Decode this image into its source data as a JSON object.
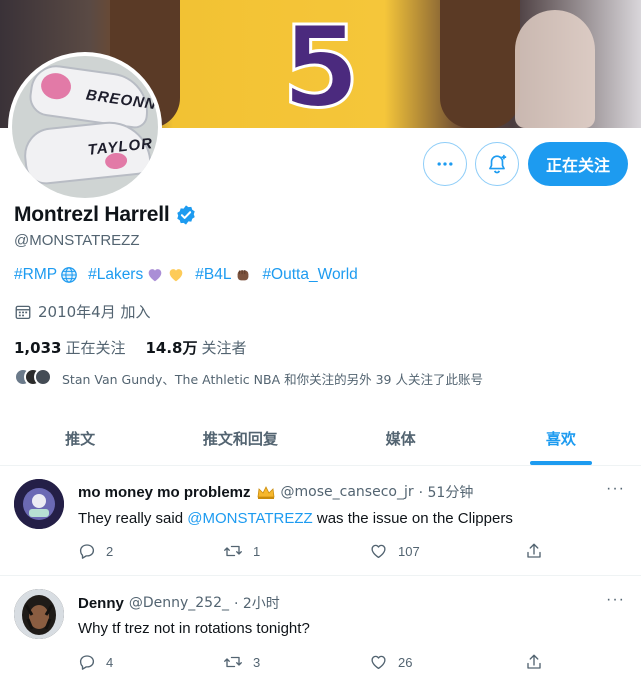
{
  "banner": {
    "jersey_number": "5"
  },
  "avatar": {
    "shoe_top_label": "BREONNA",
    "shoe_bottom_label": "TAYLOR"
  },
  "actions": {
    "follow_label": "正在关注"
  },
  "profile": {
    "display_name": "Montrezl Harrell",
    "handle": "@MONSTATREZZ",
    "bio": {
      "tag1": "#RMP",
      "tag2": "#Lakers",
      "tag3": "#B4L",
      "tag4": "#Outta_World"
    },
    "joined": "2010年4月 加入",
    "following_count": "1,033",
    "following_label": "正在关注",
    "followers_count": "14.8万",
    "followers_label": "关注者",
    "followed_by": "Stan Van Gundy、The Athletic NBA 和你关注的另外 39 人关注了此账号"
  },
  "tabs": [
    {
      "label": "推文"
    },
    {
      "label": "推文和回复"
    },
    {
      "label": "媒体"
    },
    {
      "label": "喜欢"
    }
  ],
  "tweets": [
    {
      "name": "mo money mo problemz",
      "handle": "@mose_canseco_jr",
      "time": "· 51分钟",
      "text_before": "They really said ",
      "mention": "@MONSTATREZZ",
      "text_after": " was the issue on the Clippers",
      "replies": "2",
      "retweets": "1",
      "likes": "107"
    },
    {
      "name": "Denny",
      "handle": "@Denny_252_",
      "time": "· 2小时",
      "text_before": "Why tf trez not in rotations tonight?",
      "mention": "",
      "text_after": "",
      "replies": "4",
      "retweets": "3",
      "likes": "26"
    }
  ],
  "colors": {
    "accent": "#1d9bf0",
    "text": "#0f1419",
    "muted": "#536471",
    "border": "#eff3f4"
  },
  "icons": [
    "more-icon",
    "bell-plus-icon",
    "verified-badge-icon",
    "globe-icon",
    "calendar-icon",
    "reply-icon",
    "retweet-icon",
    "like-icon",
    "share-icon"
  ]
}
